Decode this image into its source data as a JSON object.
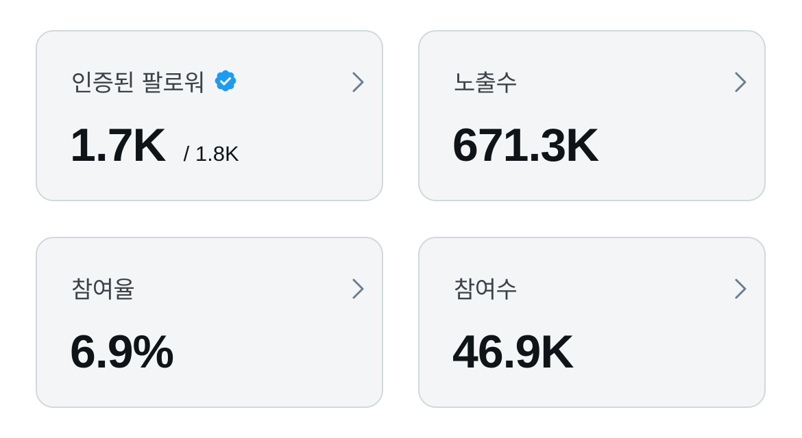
{
  "cards": [
    {
      "id": "verified",
      "label": "인증된 팔로워",
      "value": "1.7K",
      "sub": "/ 1.8K",
      "has_badge": true
    },
    {
      "id": "impressions",
      "label": "노출수",
      "value": "671.3K"
    },
    {
      "id": "engagement_rate",
      "label": "참여율",
      "value": "6.9%"
    },
    {
      "id": "engagements",
      "label": "참여수",
      "value": "46.9K"
    }
  ],
  "colors": {
    "badge": "#1d9bf0",
    "chevron": "#6a7e8d",
    "card_bg": "#f4f5f6",
    "card_border": "#cfd9de",
    "value_text": "#0f1419",
    "label_text": "#3b4248"
  },
  "icons": {
    "badge": "verified-badge-icon",
    "chevron": "chevron-right-icon"
  }
}
